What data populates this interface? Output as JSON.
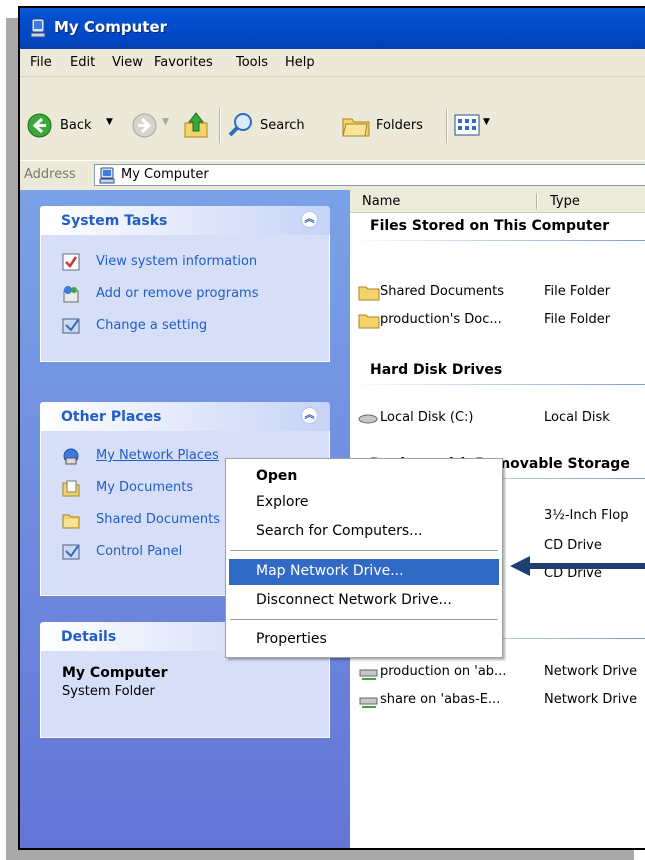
{
  "window": {
    "title": "My Computer"
  },
  "menu": [
    "File",
    "Edit",
    "View",
    "Favorites",
    "Tools",
    "Help"
  ],
  "toolbar": {
    "back": "Back",
    "search": "Search",
    "folders": "Folders"
  },
  "address": {
    "label": "Address",
    "value": "My Computer"
  },
  "system_tasks": {
    "title": "System Tasks",
    "items": [
      "View system information",
      "Add or remove programs",
      "Change a setting"
    ]
  },
  "other_places": {
    "title": "Other Places",
    "items": [
      "My Network Places",
      "My Documents",
      "Shared Documents",
      "Control Panel"
    ]
  },
  "details": {
    "title": "Details",
    "name": "My Computer",
    "desc": "System Folder"
  },
  "columns": {
    "name": "Name",
    "type": "Type"
  },
  "groups": {
    "files_stored": "Files Stored on This Computer",
    "hard_disk": "Hard Disk Drives",
    "removable": "Devices with Removable Storage"
  },
  "files": [
    {
      "name": "Shared Documents",
      "type": "File Folder"
    },
    {
      "name": "production's Doc...",
      "type": "File Folder"
    }
  ],
  "disks": [
    {
      "name": "Local Disk (C:)",
      "type": "Local Disk"
    }
  ],
  "removable_types": [
    "3½-Inch Flop",
    "CD Drive",
    "CD Drive"
  ],
  "network_drives": [
    {
      "name": "production on 'ab...",
      "type": "Network Drive"
    },
    {
      "name": "share on 'abas-E...",
      "type": "Network Drive"
    }
  ],
  "context_menu": {
    "open": "Open",
    "explore": "Explore",
    "search": "Search for Computers...",
    "map": "Map Network Drive...",
    "disconnect": "Disconnect Network Drive...",
    "properties": "Properties"
  },
  "colors": {
    "selection": "#316ac5",
    "title_bar": "#0450d0",
    "task_link": "#215dc6",
    "annotation_arrow": "#1f3f73"
  }
}
